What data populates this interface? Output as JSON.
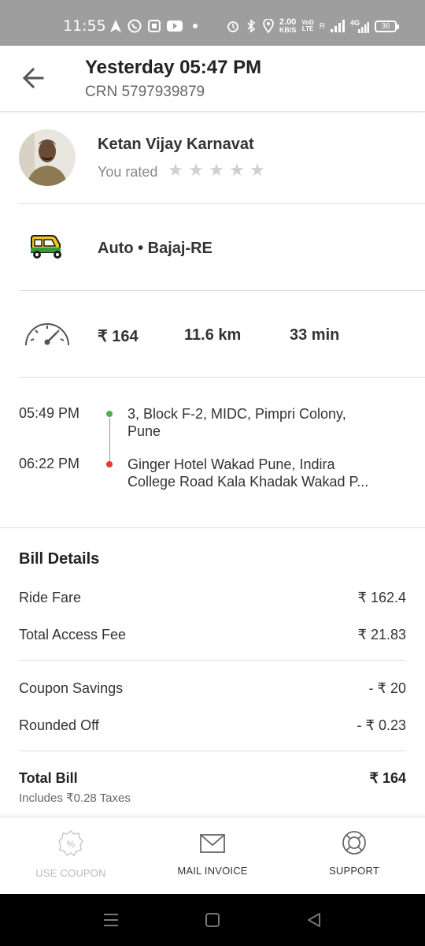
{
  "status_bar": {
    "time": "11:55",
    "net_speed_value": "2.00",
    "net_speed_unit": "KB/S",
    "volte_top": "VoD",
    "volte_bottom": "LTE",
    "roaming": "R",
    "network": "4G",
    "battery": "36"
  },
  "header": {
    "title": "Yesterday 05:47 PM",
    "crn": "CRN 5797939879"
  },
  "driver": {
    "name": "Ketan Vijay Karnavat",
    "rated_label": "You rated",
    "rating": 0,
    "max_rating": 5
  },
  "vehicle": {
    "label": "Auto • Bajaj-RE"
  },
  "trip_stats": {
    "fare": "₹ 164",
    "distance": "11.6 km",
    "duration": "33 min"
  },
  "route": {
    "pickup_time": "05:49 PM",
    "pickup_address_line1": "3, Block F-2, MIDC, Pimpri Colony,",
    "pickup_address_line2": "Pune",
    "drop_time": "06:22 PM",
    "drop_address_line1": "Ginger Hotel Wakad Pune, Indira",
    "drop_address_line2": "College Road Kala Khadak Wakad P...",
    "pickup_color": "#4caf50",
    "drop_color": "#e53935"
  },
  "bill": {
    "title": "Bill Details",
    "ride_fare_label": "Ride Fare",
    "ride_fare_value": "₹ 162.4",
    "access_fee_label": "Total Access Fee",
    "access_fee_value": "₹ 21.83",
    "coupon_label": "Coupon Savings",
    "coupon_value": "- ₹ 20",
    "rounded_label": "Rounded Off",
    "rounded_value": "- ₹ 0.23",
    "total_label": "Total Bill",
    "total_value": "₹ 164",
    "tax_note": "Includes ₹0.28 Taxes"
  },
  "actions": {
    "use_coupon": "USE COUPON",
    "mail_invoice": "MAIL INVOICE",
    "support": "SUPPORT"
  },
  "icons": {
    "back": "arrow-left-icon",
    "vehicle": "auto-rickshaw-icon",
    "meter": "speedometer-icon",
    "coupon": "percent-badge-icon",
    "mail": "envelope-icon",
    "support": "lifebuoy-icon"
  }
}
